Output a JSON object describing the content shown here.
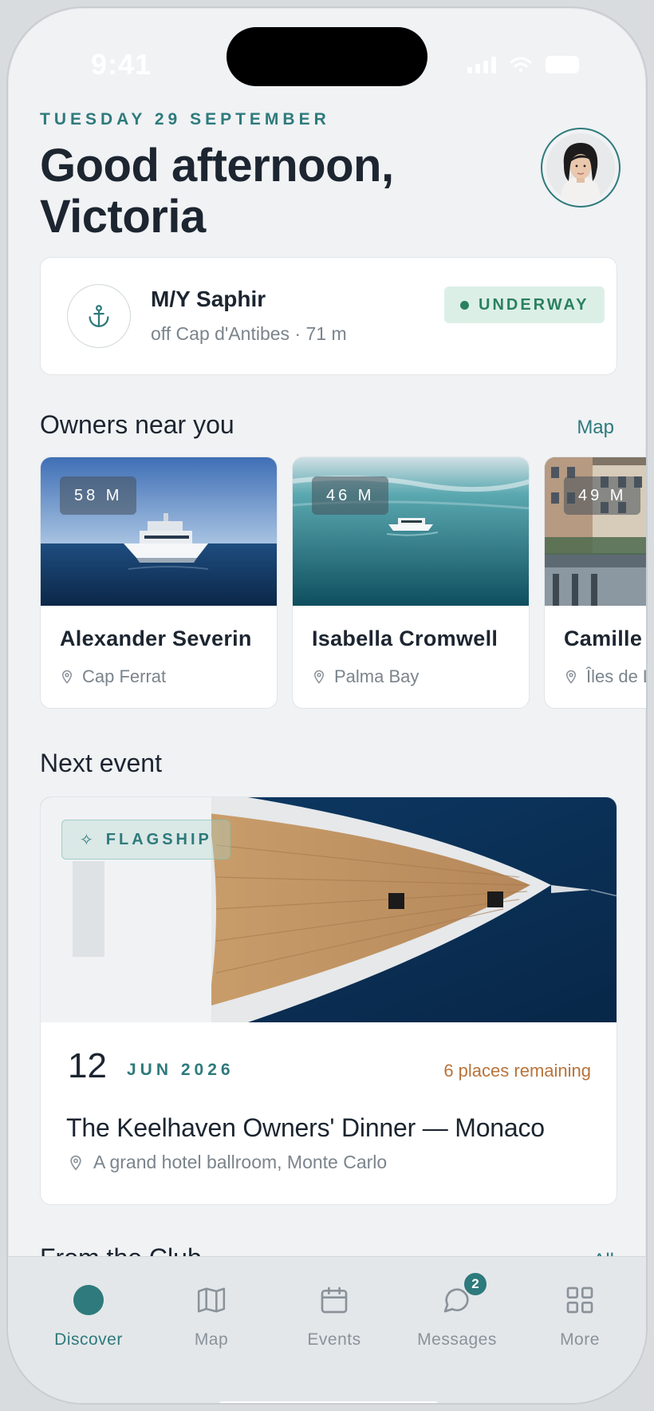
{
  "status_bar": {
    "time": "9:41"
  },
  "header": {
    "date": "TUESDAY 29 SEPTEMBER",
    "greeting_line1": "Good afternoon,",
    "greeting_line2": "Victoria"
  },
  "vessel": {
    "name": "M/Y Saphir",
    "location": "off Cap d'Antibes · 71 m",
    "status": "UNDERWAY",
    "status_color": "#2a8060"
  },
  "owners_section": {
    "title": "Owners near you",
    "link": "Map",
    "owners": [
      {
        "size": "58 M",
        "name": "Alexander Severin",
        "location": "Cap Ferrat"
      },
      {
        "size": "46 M",
        "name": "Isabella Cromwell",
        "location": "Palma Bay"
      },
      {
        "size": "49 M",
        "name": "Camille D",
        "location": "Îles de L"
      }
    ]
  },
  "event_section": {
    "title": "Next event",
    "tag": "FLAGSHIP",
    "day": "12",
    "month_year": "JUN 2026",
    "remaining": "6 places remaining",
    "event_title": "The Keelhaven Owners' Dinner — Monaco",
    "place": "A grand hotel ballroom, Monte Carlo"
  },
  "club_section": {
    "title": "From the Club",
    "link": "All"
  },
  "tabs": [
    {
      "label": "Discover",
      "icon": "discover-icon",
      "active": true
    },
    {
      "label": "Map",
      "icon": "map-icon"
    },
    {
      "label": "Events",
      "icon": "calendar-icon"
    },
    {
      "label": "Messages",
      "icon": "chat-icon",
      "badge": "2"
    },
    {
      "label": "More",
      "icon": "grid-icon"
    }
  ],
  "colors": {
    "accent": "#2e7a7c",
    "background": "#f0f2f4",
    "warning": "#b8733a"
  }
}
